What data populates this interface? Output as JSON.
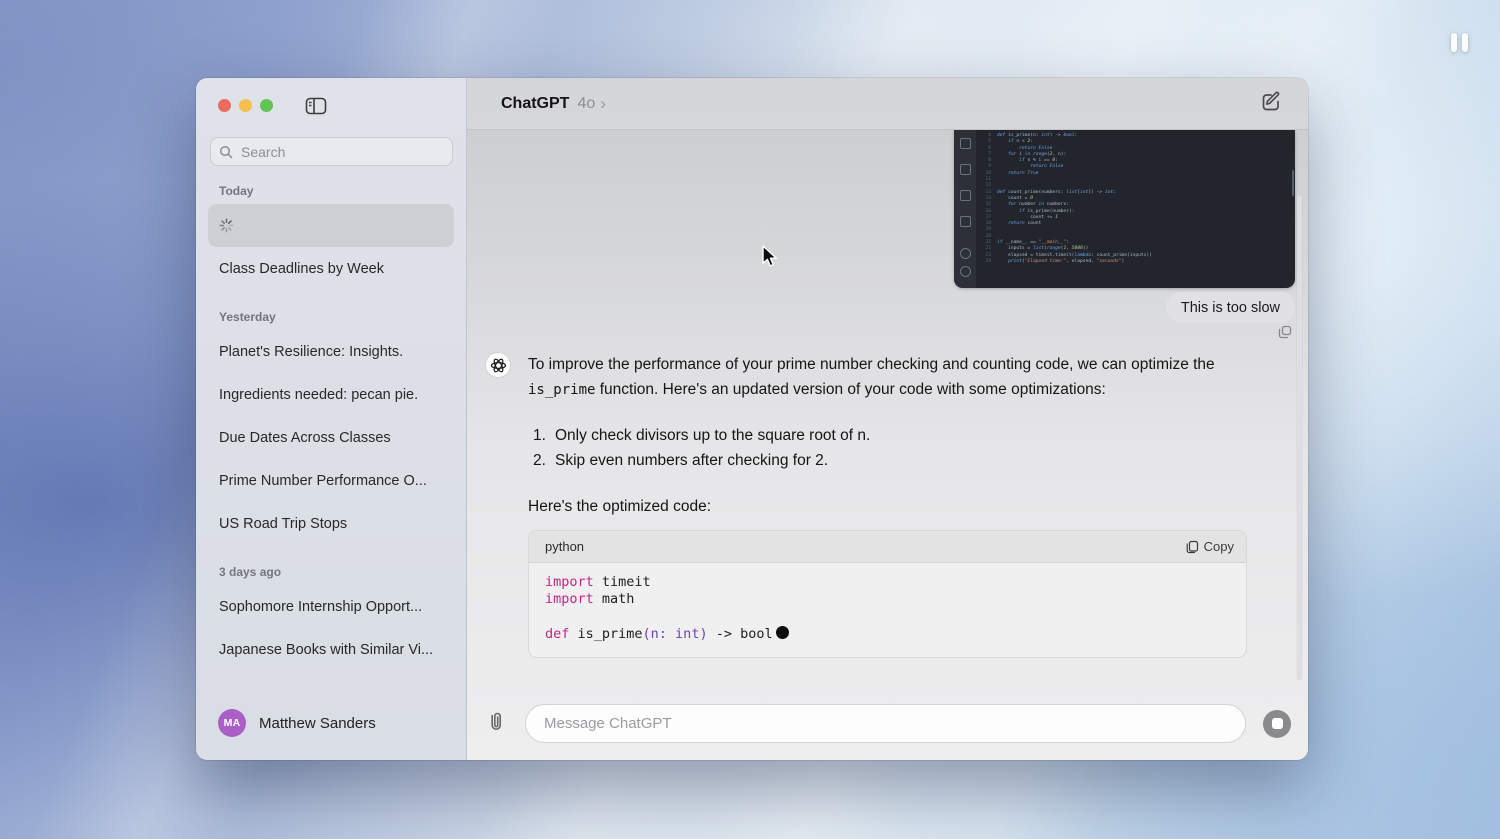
{
  "desktop": {
    "recording_indicator": "pause"
  },
  "icons": {
    "chevron_right": "›"
  },
  "colors": {
    "traffic_red": "#ed6a5e",
    "traffic_yellow": "#f4bf4f",
    "traffic_green": "#61c554",
    "avatar_purple": "#a95fc5",
    "user_bubble": "#e1e1e3",
    "editor_background": "#22262c",
    "keyword_magenta": "#c02585",
    "type_purple": "#6e44b4"
  },
  "window": {
    "header": {
      "app_title": "ChatGPT",
      "model": "4o"
    },
    "sidebar": {
      "search_placeholder": "Search",
      "sections": [
        {
          "label": "Today",
          "items": [
            {
              "loading": true,
              "selected": true,
              "label": ""
            },
            {
              "label": "Class Deadlines by Week"
            }
          ]
        },
        {
          "label": "Yesterday",
          "items": [
            {
              "label": "Planet's Resilience: Insights."
            },
            {
              "label": "Ingredients needed: pecan pie."
            },
            {
              "label": "Due Dates Across Classes"
            },
            {
              "label": "Prime Number Performance O..."
            },
            {
              "label": "US Road Trip Stops"
            }
          ]
        },
        {
          "label": "3 days ago",
          "items": [
            {
              "label": "Sophomore Internship Opport..."
            },
            {
              "label": "Japanese Books with Similar Vi..."
            }
          ]
        }
      ],
      "user": {
        "initials": "MA",
        "name": "Matthew Sanders"
      }
    },
    "chat": {
      "user_message": "This is too slow",
      "editor_image": {
        "lines": [
          {
            "num": 4,
            "code": "def is_prime(n: int) -> bool:"
          },
          {
            "num": 5,
            "code": "    if n < 2:"
          },
          {
            "num": 6,
            "code": "        return False"
          },
          {
            "num": 7,
            "code": "    for i in range(2, n):"
          },
          {
            "num": 8,
            "code": "        if n % i == 0:"
          },
          {
            "num": 9,
            "code": "            return False"
          },
          {
            "num": 10,
            "code": "    return True"
          },
          {
            "num": 11,
            "code": ""
          },
          {
            "num": 12,
            "code": ""
          },
          {
            "num": 13,
            "code": "def count_prime(numbers: list[int]) -> int:"
          },
          {
            "num": 14,
            "code": "    count = 0"
          },
          {
            "num": 15,
            "code": "    for number in numbers:"
          },
          {
            "num": 16,
            "code": "        if is_prime(number):"
          },
          {
            "num": 17,
            "code": "            count += 1"
          },
          {
            "num": 18,
            "code": "    return count"
          },
          {
            "num": 19,
            "code": ""
          },
          {
            "num": 20,
            "code": ""
          },
          {
            "num": 21,
            "code": "if __name__ == \"__main__\":"
          },
          {
            "num": 22,
            "code": "    inputs = list(range(1, 5000))"
          },
          {
            "num": 23,
            "code": "    elapsed = timeit.timeit(lambda: count_prime(inputs))"
          },
          {
            "num": 24,
            "code": "    print(\"Elapsed time:\", elapsed, \"seconds\")"
          }
        ]
      },
      "assistant": {
        "paragraph1_pre": "To improve the performance of your prime number checking and counting code, we can optimize the ",
        "inline_code": "is_prime",
        "paragraph1_post": " function. Here's an updated version of your code with some optimizations:",
        "list": [
          "Only check divisors up to the square root of n.",
          "Skip even numbers after checking for 2."
        ],
        "paragraph2": "Here's the optimized code:",
        "code_block": {
          "language": "python",
          "copy_label": "Copy",
          "tokens": {
            "import1": "import",
            "module1": " timeit",
            "import2": "import",
            "module2": " math",
            "def_kw": "def",
            "func_name": " is_prime",
            "params": "(n: int)",
            "return_type": " -> bool"
          }
        }
      }
    },
    "composer": {
      "placeholder": "Message ChatGPT"
    }
  }
}
